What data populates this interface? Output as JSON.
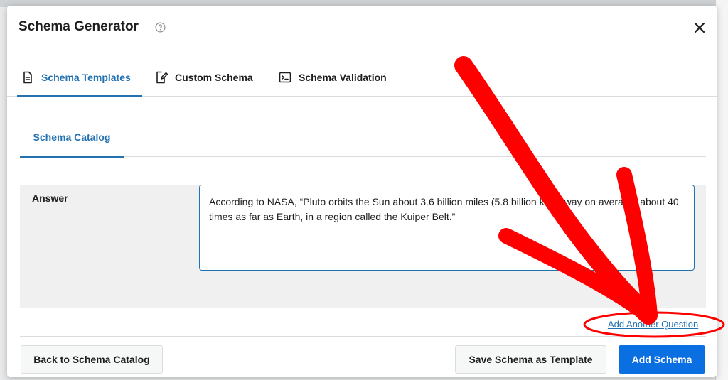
{
  "modal": {
    "title": "Schema Generator",
    "help_icon": "question-circle-icon",
    "close_icon": "close-icon"
  },
  "tabs": [
    {
      "label": "Schema Templates",
      "icon": "document-icon",
      "active": true
    },
    {
      "label": "Custom Schema",
      "icon": "edit-document-icon",
      "active": false
    },
    {
      "label": "Schema Validation",
      "icon": "terminal-icon",
      "active": false
    }
  ],
  "subtabs": [
    {
      "label": "Schema Catalog",
      "active": true
    }
  ],
  "form": {
    "answer_label": "Answer",
    "answer_value": "According to NASA, “Pluto orbits the Sun about 3.6 billion miles (5.8 billion km) away on average, about 40 times as far as Earth, in a region called the Kuiper Belt.”"
  },
  "links": {
    "add_question": "Add Another Question"
  },
  "footer": {
    "back_label": "Back to Schema Catalog",
    "save_template_label": "Save Schema as Template",
    "add_schema_label": "Add Schema"
  },
  "colors": {
    "accent": "#2271b1",
    "primary_button": "#0a6fe0",
    "annotation_red": "#ff0000"
  }
}
